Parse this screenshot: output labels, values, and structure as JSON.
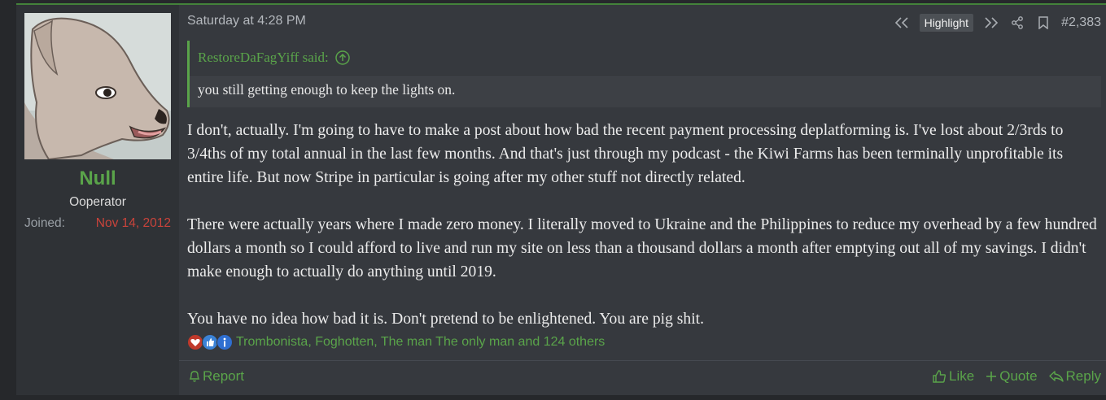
{
  "user": {
    "name": "Null",
    "title": "Ooperator",
    "joined_label": "Joined:",
    "joined_value": "Nov 14, 2012"
  },
  "post": {
    "timestamp": "Saturday at 4:28 PM",
    "highlight_label": "Highlight",
    "post_number": "#2,383",
    "quote": {
      "author": "RestoreDaFagYiff said:",
      "text": "you still getting enough to keep the lights on."
    },
    "paragraphs": [
      "I don't, actually. I'm going to have to make a post about how bad the recent payment processing deplatforming is. I've lost about 2/3rds to 3/4ths of my total annual in the last few months. And that's just through my podcast - the Kiwi Farms has been terminally unprofitable its entire life. But now Stripe in particular is going after my other stuff not directly related.",
      "There were actually years where I made zero money. I literally moved to Ukraine and the Philippines to reduce my overhead by a few hundred dollars a month so I could afford to live and run my site on less than a thousand dollars a month after emptying out all of my savings. I didn't make enough to actually do anything until 2019.",
      "You have no idea how bad it is. Don't pretend to be enlightened. You are pig shit."
    ],
    "reactions_text": "Trombonista, Foghotten, The man The only man and 124 others",
    "reaction_icons": [
      "heart-icon",
      "thumbs-up-icon",
      "info-icon"
    ]
  },
  "footer": {
    "report_label": "Report",
    "like_label": "Like",
    "quote_label": "Quote",
    "reply_label": "Reply"
  },
  "colors": {
    "accent_green": "#5aa44a",
    "joined_red": "#c9433b",
    "post_bg": "#36393e",
    "sidebar_bg": "#2f3236"
  }
}
